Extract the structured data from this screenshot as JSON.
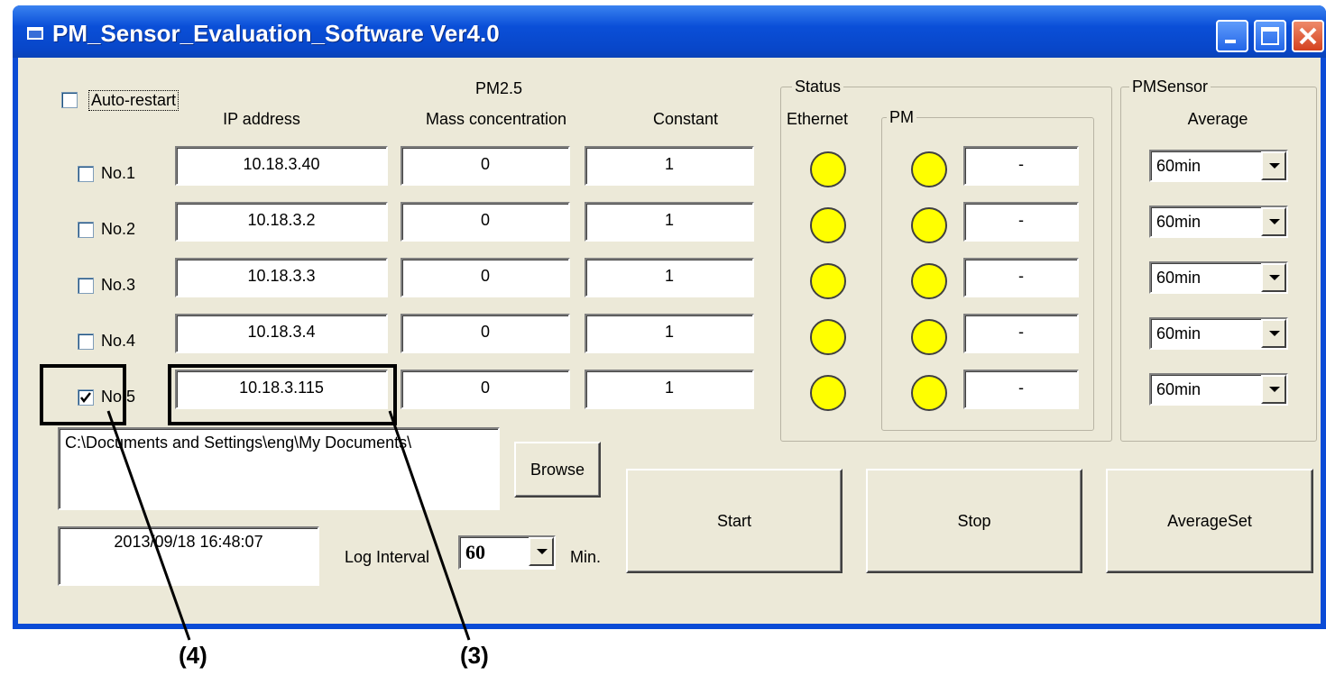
{
  "window": {
    "title": "PM_Sensor_Evaluation_Software Ver4.0"
  },
  "auto_restart": {
    "label": "Auto-restart",
    "checked": false
  },
  "headers": {
    "ip": "IP address",
    "pm25": "PM2.5",
    "mass": "Mass concentration",
    "constant": "Constant",
    "status_group": "Status",
    "ethernet": "Ethernet",
    "pm_group": "PM",
    "pmsensor_group": "PMSensor",
    "average": "Average"
  },
  "rows": [
    {
      "label": "No.1",
      "checked": false,
      "ip": "10.18.3.40",
      "mass": "0",
      "constant": "1",
      "pm_value": "-",
      "average": "60min"
    },
    {
      "label": "No.2",
      "checked": false,
      "ip": "10.18.3.2",
      "mass": "0",
      "constant": "1",
      "pm_value": "-",
      "average": "60min"
    },
    {
      "label": "No.3",
      "checked": false,
      "ip": "10.18.3.3",
      "mass": "0",
      "constant": "1",
      "pm_value": "-",
      "average": "60min"
    },
    {
      "label": "No.4",
      "checked": false,
      "ip": "10.18.3.4",
      "mass": "0",
      "constant": "1",
      "pm_value": "-",
      "average": "60min"
    },
    {
      "label": "No.5",
      "checked": true,
      "ip": "10.18.3.115",
      "mass": "0",
      "constant": "1",
      "pm_value": "-",
      "average": "60min"
    }
  ],
  "colors": {
    "led": "#ffff00",
    "titlebar": "#0a4fd8",
    "face": "#ece9d8"
  },
  "path": "C:\\Documents and Settings\\eng\\My Documents\\",
  "buttons": {
    "browse": "Browse",
    "start": "Start",
    "stop": "Stop",
    "average_set": "AverageSet"
  },
  "datetime": "2013/09/18 16:48:07",
  "log_interval": {
    "label": "Log Interval",
    "value": "60",
    "unit": "Min."
  },
  "callouts": {
    "ip": "(3)",
    "checkbox": "(4)"
  }
}
